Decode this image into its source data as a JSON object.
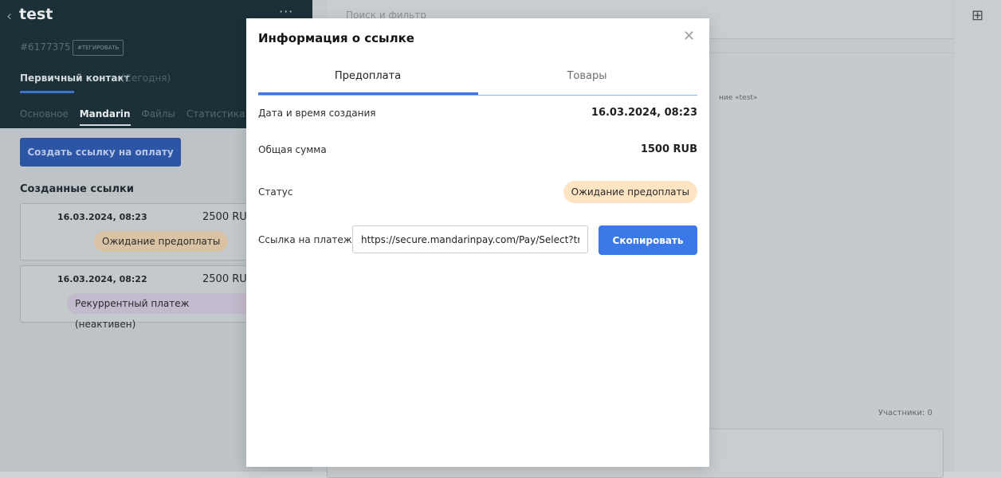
{
  "lead": {
    "title": "test",
    "id": "#6177375",
    "tag_button": "#ТЕГИРОВАТЬ",
    "stage": "Первичный контакт",
    "stage_date": "(Сегодня)",
    "tabs": [
      "Основное",
      "Mandarin",
      "Файлы",
      "Статистика"
    ],
    "active_tab": "Mandarin"
  },
  "mandarin": {
    "create_button": "Создать ссылку на оплату",
    "created_links_title": "Созданные ссылки",
    "links": [
      {
        "date": "16.03.2024, 08:23",
        "amount": "2500 RU",
        "status": "Ожидание предоплаты",
        "status_color": "#d9c3a4"
      },
      {
        "date": "16.03.2024, 08:22",
        "amount": "2500 RU",
        "status": "Рекуррентный платеж (неактивен)",
        "status_color": "#c3bbcd"
      }
    ]
  },
  "feed": {
    "search_placeholder": "Поиск и фильтр",
    "note_fragment": "ние «test»",
    "members": "Участники: 0"
  },
  "modal": {
    "title": "Информация о ссылке",
    "tabs": [
      "Предоплата",
      "Товары"
    ],
    "active_tab": "Предоплата",
    "created_label": "Дата и время создания",
    "created_value": "16.03.2024, 08:23",
    "total_label": "Общая сумма",
    "total_value": "1500 RUB",
    "status_label": "Статус",
    "status_value": "Ожидание предоплаты",
    "status_color": "#fde5c4",
    "link_label": "Ссылка на платеж",
    "link_value": "https://secure.mandarinpay.com/Pay/Select?trai",
    "copy_button": "Скопировать",
    "accent_color": "#3b79e8"
  }
}
